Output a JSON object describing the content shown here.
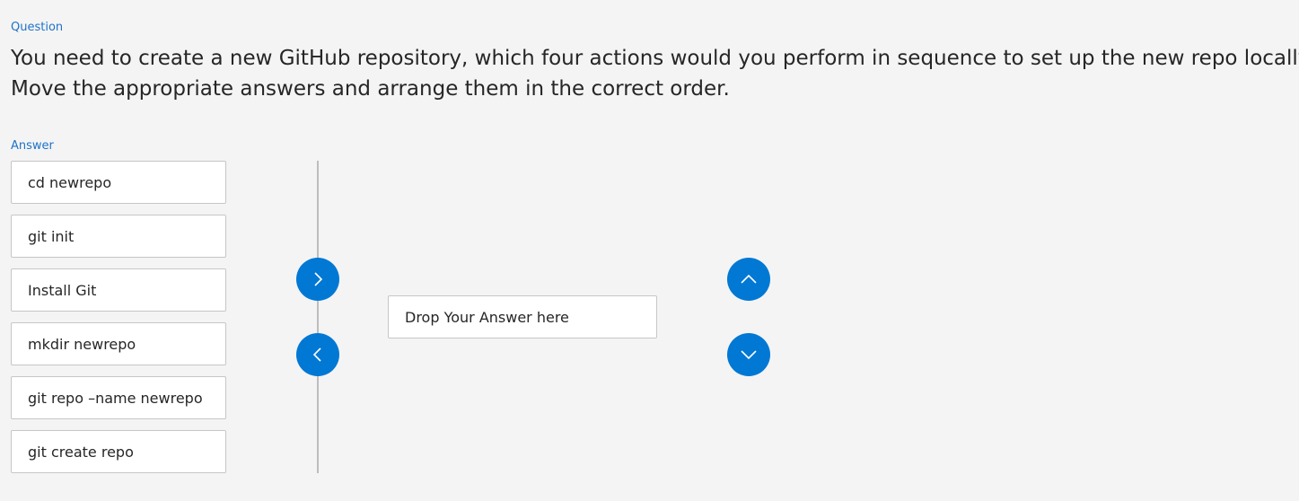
{
  "question": {
    "label": "Question",
    "line1": "You need to create a new GitHub repository, which four actions would you perform in sequence to set up the new repo locally?",
    "line2": "Move the appropriate answers and arrange them in the correct order."
  },
  "answer": {
    "label": "Answer",
    "options": [
      "cd newrepo",
      "git init",
      "Install Git",
      "mkdir newrepo",
      "git repo –name newrepo",
      "git create repo"
    ],
    "drop_zone_text": "Drop Your Answer here"
  },
  "controls": {
    "move_right_icon": "chevron-right-icon",
    "move_left_icon": "chevron-left-icon",
    "move_up_icon": "chevron-up-icon",
    "move_down_icon": "chevron-down-icon"
  },
  "colors": {
    "background": "#f4f4f4",
    "accent": "#0078d4",
    "label": "#1e73c8",
    "card_border": "#c6c6c6"
  }
}
